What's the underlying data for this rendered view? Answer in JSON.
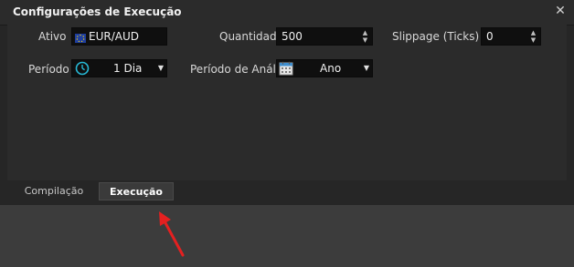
{
  "window": {
    "title": "Configurações de Execução",
    "close_icon": "close-icon"
  },
  "fields": {
    "ativo": {
      "label": "Ativo",
      "value": "EUR/AUD",
      "icon": "eu-flag-icon"
    },
    "quantidade": {
      "label": "Quantidade",
      "value": "500"
    },
    "slippage": {
      "label": "Slippage (Ticks)",
      "value": "0"
    },
    "periodo": {
      "label": "Período",
      "value": "1 Dia",
      "icon": "clock-icon"
    },
    "periodo_analise": {
      "label": "Período de Análise",
      "value": "Ano",
      "icon": "calendar-icon"
    }
  },
  "tabs": [
    {
      "label": "Compilação",
      "active": false
    },
    {
      "label": "Execução",
      "active": true
    }
  ],
  "colors": {
    "accent_clock": "#27b9d6",
    "annotation_arrow": "#e52020",
    "eu_flag": "#1f3fa0",
    "eu_stars": "#f4d000"
  }
}
